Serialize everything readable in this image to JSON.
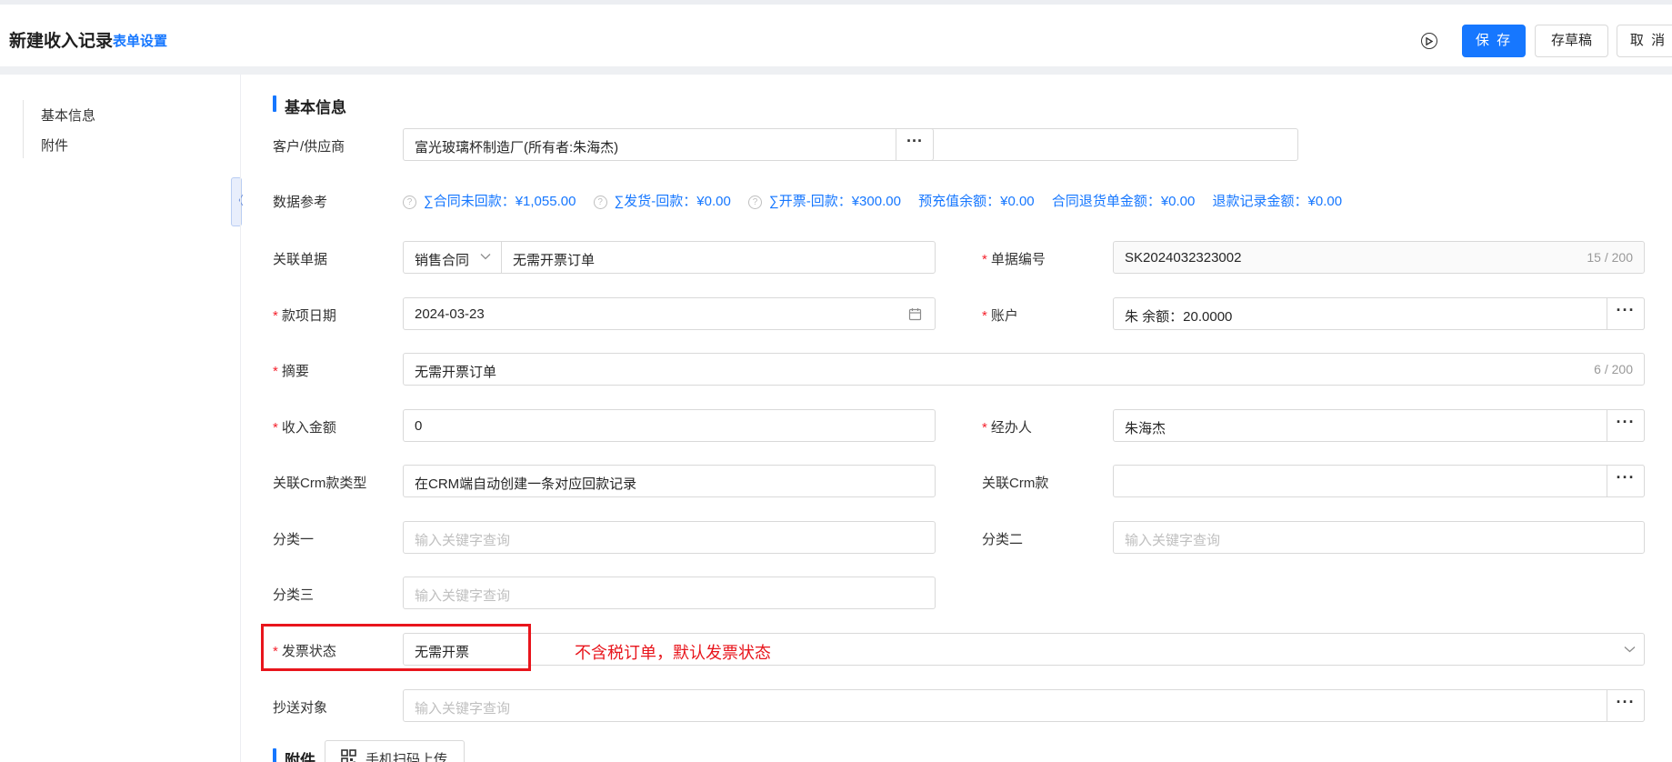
{
  "header": {
    "title": "新建收入记录",
    "form_settings": "表单设置",
    "save": "保 存",
    "draft": "存草稿",
    "cancel": "取 消"
  },
  "sidebar": {
    "items": [
      {
        "label": "基本信息"
      },
      {
        "label": "附件"
      }
    ]
  },
  "sections": {
    "basic": "基本信息",
    "attachment": "附件"
  },
  "form": {
    "customer": {
      "label": "客户/供应商",
      "value": "富光玻璃杯制造厂(所有者:朱海杰)"
    },
    "data_ref": {
      "label": "数据参考",
      "items": [
        {
          "text": "∑合同未回款：¥1,055.00",
          "help": "?"
        },
        {
          "text": "∑发货-回款：¥0.00",
          "help": "?"
        },
        {
          "text": "∑开票-回款：¥300.00",
          "help": "?"
        },
        {
          "text": "预充值余额：¥0.00"
        },
        {
          "text": "合同退货单金额：¥0.00"
        },
        {
          "text": "退款记录金额：¥0.00"
        }
      ]
    },
    "related_doc": {
      "label": "关联单据",
      "type": "销售合同",
      "value": "无需开票订单"
    },
    "doc_no": {
      "label": "单据编号",
      "required": "*",
      "value": "SK2024032323002",
      "count": "15 / 200"
    },
    "date": {
      "label": "款项日期",
      "required": "*",
      "value": "2024-03-23"
    },
    "account": {
      "label": "账户",
      "required": "*",
      "value": "朱 余额：20.0000"
    },
    "summary": {
      "label": "摘要",
      "required": "*",
      "value": "无需开票订单",
      "count": "6 / 200"
    },
    "amount": {
      "label": "收入金额",
      "required": "*",
      "value": "0"
    },
    "handler": {
      "label": "经办人",
      "required": "*",
      "value": "朱海杰"
    },
    "crm_type": {
      "label": "关联Crm款类型",
      "value": "在CRM端自动创建一条对应回款记录"
    },
    "crm": {
      "label": "关联Crm款",
      "value": ""
    },
    "cat1": {
      "label": "分类一",
      "placeholder": "输入关键字查询"
    },
    "cat2": {
      "label": "分类二",
      "placeholder": "输入关键字查询"
    },
    "cat3": {
      "label": "分类三",
      "placeholder": "输入关键字查询"
    },
    "invoice_status": {
      "label": "发票状态",
      "required": "*",
      "value": "无需开票"
    },
    "cc": {
      "label": "抄送对象",
      "placeholder": "输入关键字查询"
    }
  },
  "annotation": "不含税订单，默认发票状态",
  "upload": {
    "label": "手机扫码上传"
  },
  "colors": {
    "primary": "#1677ff",
    "required": "#f5222d",
    "annotation": "#e8151c"
  },
  "icons": [
    "play-circle-icon",
    "question-icon",
    "chevron-down-icon",
    "calendar-icon",
    "more-dots-icon",
    "qrcode-icon",
    "collapse-left-icon"
  ]
}
